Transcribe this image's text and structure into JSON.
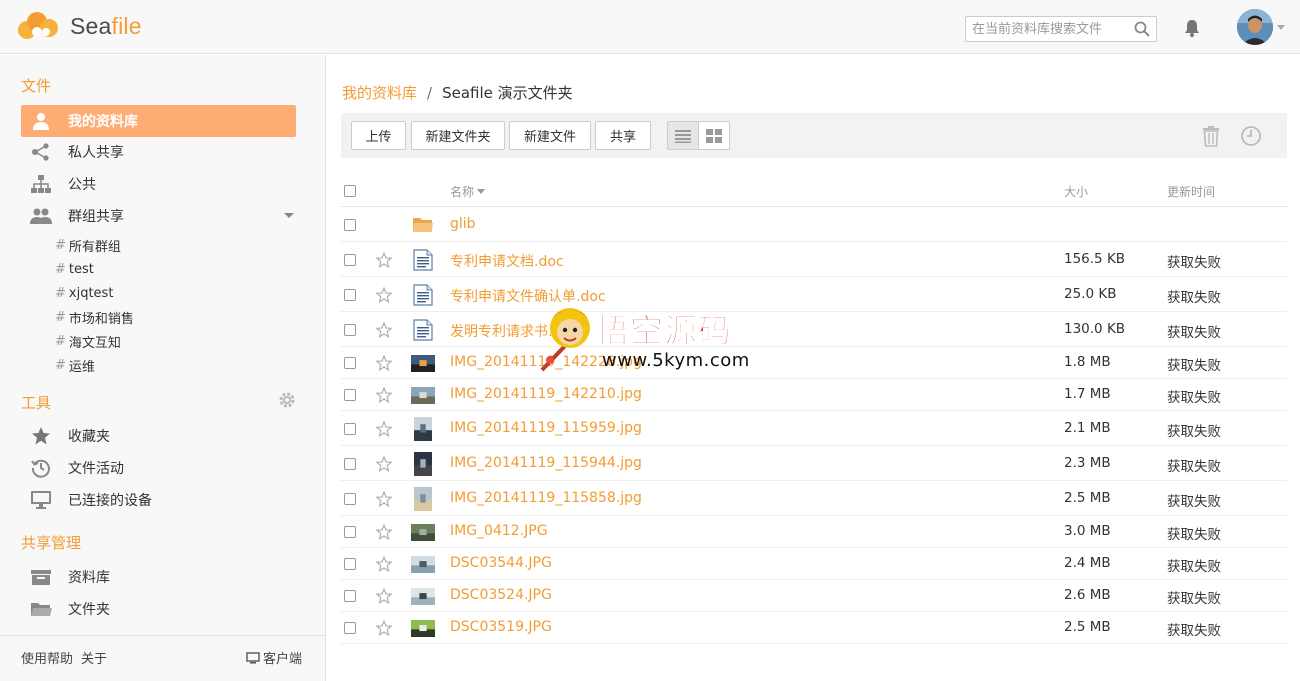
{
  "header": {
    "logo_text_a": "Sea",
    "logo_text_b": "file",
    "search_placeholder": "在当前资料库搜索文件"
  },
  "sidebar": {
    "section_files": "文件",
    "items": [
      {
        "label": "我的资料库",
        "icon": "user-icon"
      },
      {
        "label": "私人共享",
        "icon": "share-icon"
      },
      {
        "label": "公共",
        "icon": "org-icon"
      },
      {
        "label": "群组共享",
        "icon": "group-icon"
      }
    ],
    "groups": [
      "所有群组",
      "test",
      "xjqtest",
      "市场和销售",
      "海文互知",
      "运维"
    ],
    "section_tools": "工具",
    "tools": [
      {
        "label": "收藏夹",
        "icon": "star-icon"
      },
      {
        "label": "文件活动",
        "icon": "activity-icon"
      },
      {
        "label": "已连接的设备",
        "icon": "monitor-icon"
      }
    ],
    "section_share_admin": "共享管理",
    "share_admin": [
      {
        "label": "资料库",
        "icon": "library-icon"
      },
      {
        "label": "文件夹",
        "icon": "folder-icon"
      }
    ],
    "footer": {
      "help": "使用帮助",
      "about": "关于",
      "client": "客户端"
    }
  },
  "breadcrumb": {
    "parent": "我的资料库",
    "separator": "/",
    "current": "Seafile 演示文件夹"
  },
  "toolbar": {
    "upload": "上传",
    "new_folder": "新建文件夹",
    "new_file": "新建文件",
    "share": "共享"
  },
  "table": {
    "col_name": "名称",
    "col_size": "大小",
    "col_time": "更新时间",
    "rows": [
      {
        "name": "glib",
        "type": "folder",
        "size": "",
        "time": ""
      },
      {
        "name": "专利申请文档.doc",
        "type": "doc",
        "size": "156.5 KB",
        "time": "获取失败"
      },
      {
        "name": "专利申请文件确认单.doc",
        "type": "doc",
        "size": "25.0 KB",
        "time": "获取失败"
      },
      {
        "name": "发明专利请求书.doc",
        "type": "doc",
        "size": "130.0 KB",
        "time": "获取失败"
      },
      {
        "name": "IMG_20141119_142228.jpg",
        "type": "img",
        "size": "1.8 MB",
        "time": "获取失败"
      },
      {
        "name": "IMG_20141119_142210.jpg",
        "type": "img",
        "size": "1.7 MB",
        "time": "获取失败"
      },
      {
        "name": "IMG_20141119_115959.jpg",
        "type": "img",
        "size": "2.1 MB",
        "time": "获取失败"
      },
      {
        "name": "IMG_20141119_115944.jpg",
        "type": "img",
        "size": "2.3 MB",
        "time": "获取失败"
      },
      {
        "name": "IMG_20141119_115858.jpg",
        "type": "img",
        "size": "2.5 MB",
        "time": "获取失败"
      },
      {
        "name": "IMG_0412.JPG",
        "type": "img",
        "size": "3.0 MB",
        "time": "获取失败"
      },
      {
        "name": "DSC03544.JPG",
        "type": "img",
        "size": "2.4 MB",
        "time": "获取失败"
      },
      {
        "name": "DSC03524.JPG",
        "type": "img",
        "size": "2.6 MB",
        "time": "获取失败"
      },
      {
        "name": "DSC03519.JPG",
        "type": "img",
        "size": "2.5 MB",
        "time": "获取失败"
      }
    ]
  },
  "watermark": {
    "title": "悟空源码",
    "url": "www.5kym.com"
  },
  "colors": {
    "accent": "#f39c32",
    "active_bg": "#feac74"
  }
}
